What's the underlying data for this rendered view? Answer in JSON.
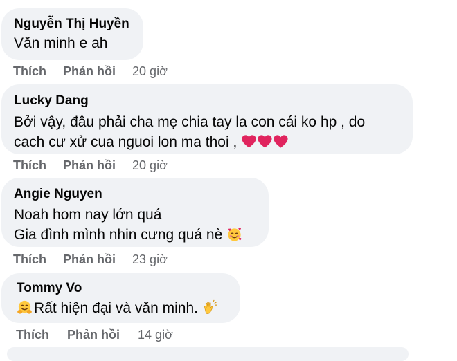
{
  "comments": [
    {
      "author": "Nguyễn Thị Huyền",
      "lines": [
        "Văn minh e ah"
      ],
      "like_label": "Thích",
      "reply_label": "Phản hồi",
      "time": "20 giờ"
    },
    {
      "author": "Lucky Dang",
      "lines": [
        "Bởi vậy, đâu phải cha mẹ chia tay la con cái ko hp , do",
        "cach cư xử cua nguoi lon ma thoi ,"
      ],
      "emoji": [
        "red-heart-icon",
        "red-heart-icon",
        "red-heart-icon"
      ],
      "like_label": "Thích",
      "reply_label": "Phản hồi",
      "time": "20 giờ"
    },
    {
      "author": "Angie Nguyen",
      "lines": [
        "Noah hom nay lớn quá",
        "Gia đình mình nhin cưng quá nè"
      ],
      "emoji": [
        "smiling-face-with-hearts-icon"
      ],
      "like_label": "Thích",
      "reply_label": "Phản hồi",
      "time": "23 giờ"
    },
    {
      "author": "Tommy Vo",
      "lines": [
        "Rất hiện đại và văn minh."
      ],
      "emoji": [
        "hugging-face-icon",
        "clapping-hands-icon"
      ],
      "like_label": "Thích",
      "reply_label": "Phản hồi",
      "time": "14 giờ"
    }
  ],
  "colors": {
    "bubble_bg": "#f0f2f5",
    "text": "#050505",
    "meta_text": "#65676b",
    "heart": "#e0245e"
  }
}
